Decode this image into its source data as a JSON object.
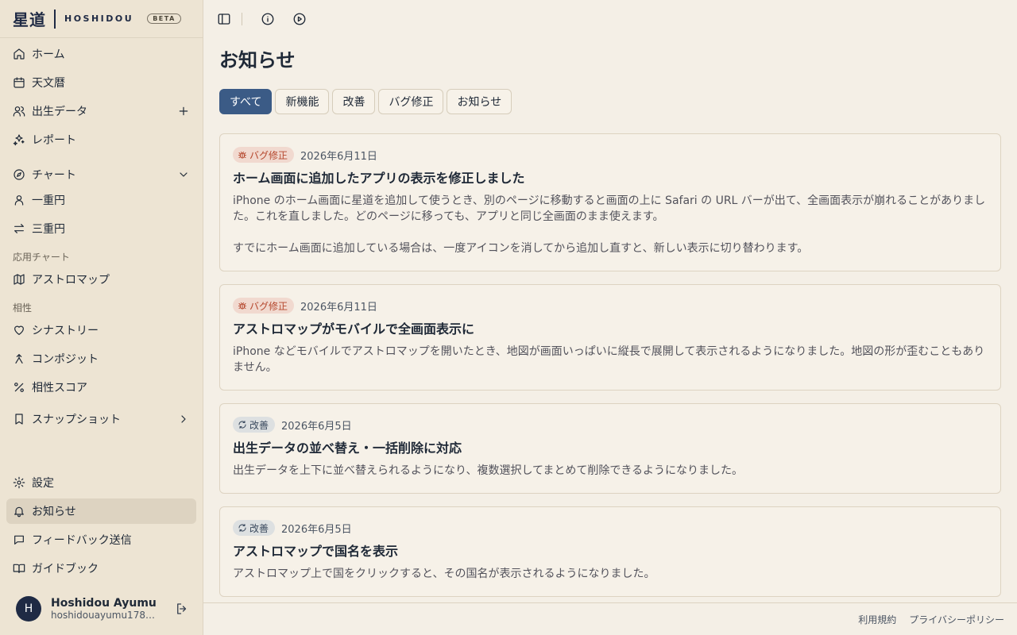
{
  "brand": {
    "kanji": "星道",
    "latin": "HOSHIDOU",
    "badge": "BETA"
  },
  "nav": {
    "home": "ホーム",
    "ephemeris": "天文暦",
    "birth_data": "出生データ",
    "reports": "レポート",
    "chart": "チャート",
    "single_wheel": "一重円",
    "triple_wheel": "三重円",
    "applied_section": "応用チャート",
    "astromap": "アストロマップ",
    "compat_section": "相性",
    "synastry": "シナストリー",
    "composite": "コンポジット",
    "compat_score": "相性スコア",
    "snapshot": "スナップショット",
    "settings": "設定",
    "news": "お知らせ",
    "feedback": "フィードバック送信",
    "guidebook": "ガイドブック"
  },
  "user": {
    "initial": "H",
    "name": "Hoshidou Ayumu",
    "email": "hoshidouayumu1781..."
  },
  "page": {
    "title": "お知らせ"
  },
  "filters": [
    "すべて",
    "新機能",
    "改善",
    "バグ修正",
    "お知らせ"
  ],
  "cards": [
    {
      "badge": "バグ修正",
      "date": "2026年6月11日",
      "title": "ホーム画面に追加したアプリの表示を修正しました",
      "body1": "iPhone のホーム画面に星道を追加して使うとき、別のページに移動すると画面の上に Safari の URL バーが出て、全画面表示が崩れることがありました。これを直しました。どのページに移っても、アプリと同じ全画面のまま使えます。",
      "body2": "すでにホーム画面に追加している場合は、一度アイコンを消してから追加し直すと、新しい表示に切り替わります。"
    },
    {
      "badge": "バグ修正",
      "date": "2026年6月11日",
      "title": "アストロマップがモバイルで全画面表示に",
      "body1": "iPhone などモバイルでアストロマップを開いたとき、地図が画面いっぱいに縦長で展開して表示されるようになりました。地図の形が歪むこともありません。"
    },
    {
      "badge": "改善",
      "date": "2026年6月5日",
      "title": "出生データの並べ替え・一括削除に対応",
      "body1": "出生データを上下に並べ替えられるようになり、複数選択してまとめて削除できるようになりました。"
    },
    {
      "badge": "改善",
      "date": "2026年6月5日",
      "title": "アストロマップで国名を表示",
      "body1": "アストロマップ上で国をクリックすると、その国名が表示されるようになりました。"
    }
  ],
  "footer": {
    "terms": "利用規約",
    "privacy": "プライバシーポリシー"
  }
}
